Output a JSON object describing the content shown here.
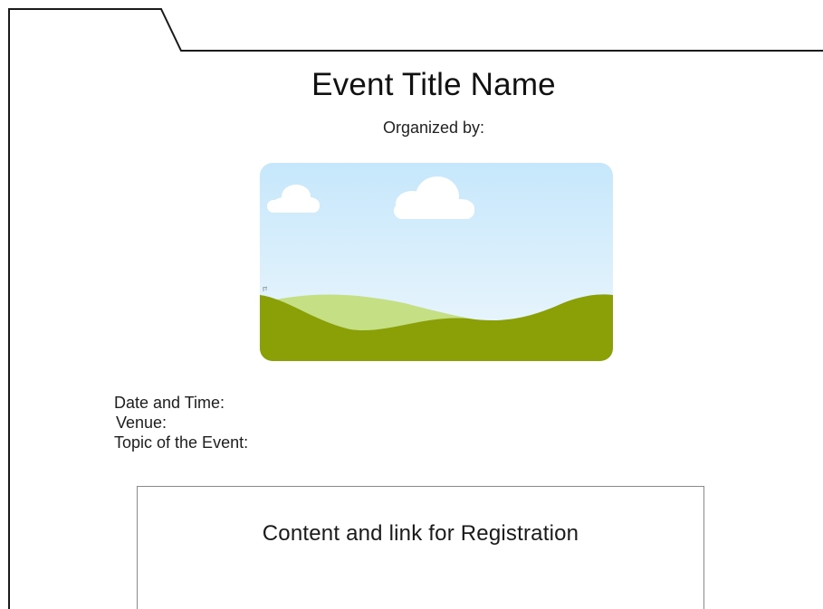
{
  "event": {
    "title": "Event Title Name",
    "organized_by_label": "Organized by:"
  },
  "hero_image": {
    "icon": "landscape-placeholder-icon",
    "sky_top_color": "#c6e7fb",
    "sky_bottom_color": "#eef7fd",
    "cloud_color": "#ffffff",
    "hill_light_color": "#c5df85",
    "hill_dark_color": "#8aa006"
  },
  "details": {
    "date_time_label": "Date and Time:",
    "venue_label": "Venue:",
    "topic_label": "Topic of the Event:"
  },
  "registration": {
    "label": "Content and link for Registration"
  }
}
